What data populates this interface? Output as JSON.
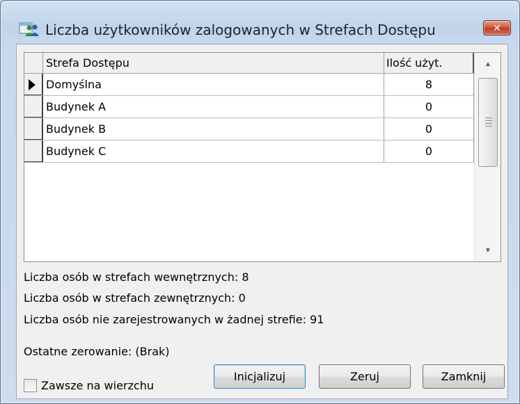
{
  "window": {
    "title": "Liczba użytkowników zalogowanych w Strefach Dostępu",
    "close_label": "✕"
  },
  "grid": {
    "columns": [
      "Strefa Dostępu",
      "Ilość użyt."
    ],
    "rows": [
      {
        "name": "Domyślna",
        "count": "8",
        "current": true
      },
      {
        "name": "Budynek A",
        "count": "0",
        "current": false
      },
      {
        "name": "Budynek B",
        "count": "0",
        "current": false
      },
      {
        "name": "Budynek C",
        "count": "0",
        "current": false
      }
    ]
  },
  "stats": {
    "internal": "Liczba osób w strefach wewnętrznych: 8",
    "external": "Liczba osób w strefach zewnętrznych: 0",
    "unregistered": "Liczba osób nie zarejestrowanych w żadnej strefie: 91",
    "last_reset": "Ostatne zerowanie: (Brak)"
  },
  "controls": {
    "always_on_top_label": "Zawsze na wierzchu",
    "always_on_top_checked": false,
    "init_label": "Inicjalizuj",
    "reset_label": "Zeruj",
    "close_label": "Zamknij"
  },
  "icons": {
    "title": "user-group-icon",
    "close": "close-icon",
    "scroll_up": "arrow-up-icon",
    "scroll_down": "arrow-down-icon",
    "row_indicator": "triangle-right-icon"
  }
}
